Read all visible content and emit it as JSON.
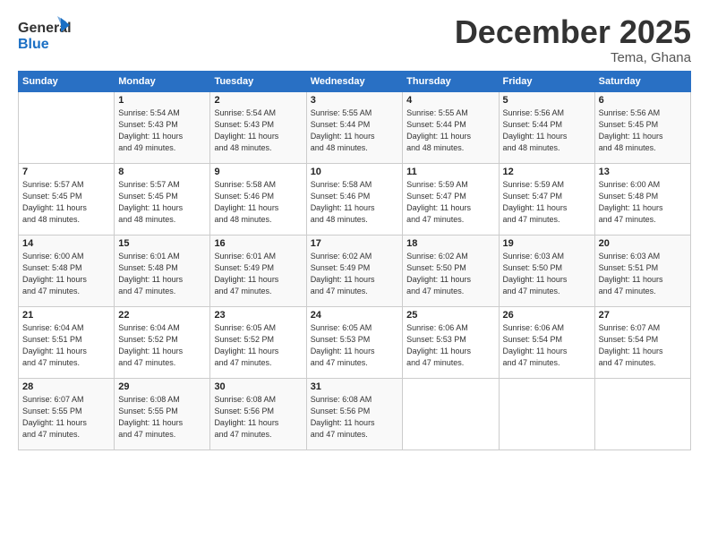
{
  "logo": {
    "line1": "General",
    "line2": "Blue"
  },
  "title": "December 2025",
  "location": "Tema, Ghana",
  "days_header": [
    "Sunday",
    "Monday",
    "Tuesday",
    "Wednesday",
    "Thursday",
    "Friday",
    "Saturday"
  ],
  "weeks": [
    [
      {
        "day": "",
        "info": ""
      },
      {
        "day": "1",
        "info": "Sunrise: 5:54 AM\nSunset: 5:43 PM\nDaylight: 11 hours\nand 49 minutes."
      },
      {
        "day": "2",
        "info": "Sunrise: 5:54 AM\nSunset: 5:43 PM\nDaylight: 11 hours\nand 48 minutes."
      },
      {
        "day": "3",
        "info": "Sunrise: 5:55 AM\nSunset: 5:44 PM\nDaylight: 11 hours\nand 48 minutes."
      },
      {
        "day": "4",
        "info": "Sunrise: 5:55 AM\nSunset: 5:44 PM\nDaylight: 11 hours\nand 48 minutes."
      },
      {
        "day": "5",
        "info": "Sunrise: 5:56 AM\nSunset: 5:44 PM\nDaylight: 11 hours\nand 48 minutes."
      },
      {
        "day": "6",
        "info": "Sunrise: 5:56 AM\nSunset: 5:45 PM\nDaylight: 11 hours\nand 48 minutes."
      }
    ],
    [
      {
        "day": "7",
        "info": "Sunrise: 5:57 AM\nSunset: 5:45 PM\nDaylight: 11 hours\nand 48 minutes."
      },
      {
        "day": "8",
        "info": "Sunrise: 5:57 AM\nSunset: 5:45 PM\nDaylight: 11 hours\nand 48 minutes."
      },
      {
        "day": "9",
        "info": "Sunrise: 5:58 AM\nSunset: 5:46 PM\nDaylight: 11 hours\nand 48 minutes."
      },
      {
        "day": "10",
        "info": "Sunrise: 5:58 AM\nSunset: 5:46 PM\nDaylight: 11 hours\nand 48 minutes."
      },
      {
        "day": "11",
        "info": "Sunrise: 5:59 AM\nSunset: 5:47 PM\nDaylight: 11 hours\nand 47 minutes."
      },
      {
        "day": "12",
        "info": "Sunrise: 5:59 AM\nSunset: 5:47 PM\nDaylight: 11 hours\nand 47 minutes."
      },
      {
        "day": "13",
        "info": "Sunrise: 6:00 AM\nSunset: 5:48 PM\nDaylight: 11 hours\nand 47 minutes."
      }
    ],
    [
      {
        "day": "14",
        "info": "Sunrise: 6:00 AM\nSunset: 5:48 PM\nDaylight: 11 hours\nand 47 minutes."
      },
      {
        "day": "15",
        "info": "Sunrise: 6:01 AM\nSunset: 5:48 PM\nDaylight: 11 hours\nand 47 minutes."
      },
      {
        "day": "16",
        "info": "Sunrise: 6:01 AM\nSunset: 5:49 PM\nDaylight: 11 hours\nand 47 minutes."
      },
      {
        "day": "17",
        "info": "Sunrise: 6:02 AM\nSunset: 5:49 PM\nDaylight: 11 hours\nand 47 minutes."
      },
      {
        "day": "18",
        "info": "Sunrise: 6:02 AM\nSunset: 5:50 PM\nDaylight: 11 hours\nand 47 minutes."
      },
      {
        "day": "19",
        "info": "Sunrise: 6:03 AM\nSunset: 5:50 PM\nDaylight: 11 hours\nand 47 minutes."
      },
      {
        "day": "20",
        "info": "Sunrise: 6:03 AM\nSunset: 5:51 PM\nDaylight: 11 hours\nand 47 minutes."
      }
    ],
    [
      {
        "day": "21",
        "info": "Sunrise: 6:04 AM\nSunset: 5:51 PM\nDaylight: 11 hours\nand 47 minutes."
      },
      {
        "day": "22",
        "info": "Sunrise: 6:04 AM\nSunset: 5:52 PM\nDaylight: 11 hours\nand 47 minutes."
      },
      {
        "day": "23",
        "info": "Sunrise: 6:05 AM\nSunset: 5:52 PM\nDaylight: 11 hours\nand 47 minutes."
      },
      {
        "day": "24",
        "info": "Sunrise: 6:05 AM\nSunset: 5:53 PM\nDaylight: 11 hours\nand 47 minutes."
      },
      {
        "day": "25",
        "info": "Sunrise: 6:06 AM\nSunset: 5:53 PM\nDaylight: 11 hours\nand 47 minutes."
      },
      {
        "day": "26",
        "info": "Sunrise: 6:06 AM\nSunset: 5:54 PM\nDaylight: 11 hours\nand 47 minutes."
      },
      {
        "day": "27",
        "info": "Sunrise: 6:07 AM\nSunset: 5:54 PM\nDaylight: 11 hours\nand 47 minutes."
      }
    ],
    [
      {
        "day": "28",
        "info": "Sunrise: 6:07 AM\nSunset: 5:55 PM\nDaylight: 11 hours\nand 47 minutes."
      },
      {
        "day": "29",
        "info": "Sunrise: 6:08 AM\nSunset: 5:55 PM\nDaylight: 11 hours\nand 47 minutes."
      },
      {
        "day": "30",
        "info": "Sunrise: 6:08 AM\nSunset: 5:56 PM\nDaylight: 11 hours\nand 47 minutes."
      },
      {
        "day": "31",
        "info": "Sunrise: 6:08 AM\nSunset: 5:56 PM\nDaylight: 11 hours\nand 47 minutes."
      },
      {
        "day": "",
        "info": ""
      },
      {
        "day": "",
        "info": ""
      },
      {
        "day": "",
        "info": ""
      }
    ]
  ]
}
